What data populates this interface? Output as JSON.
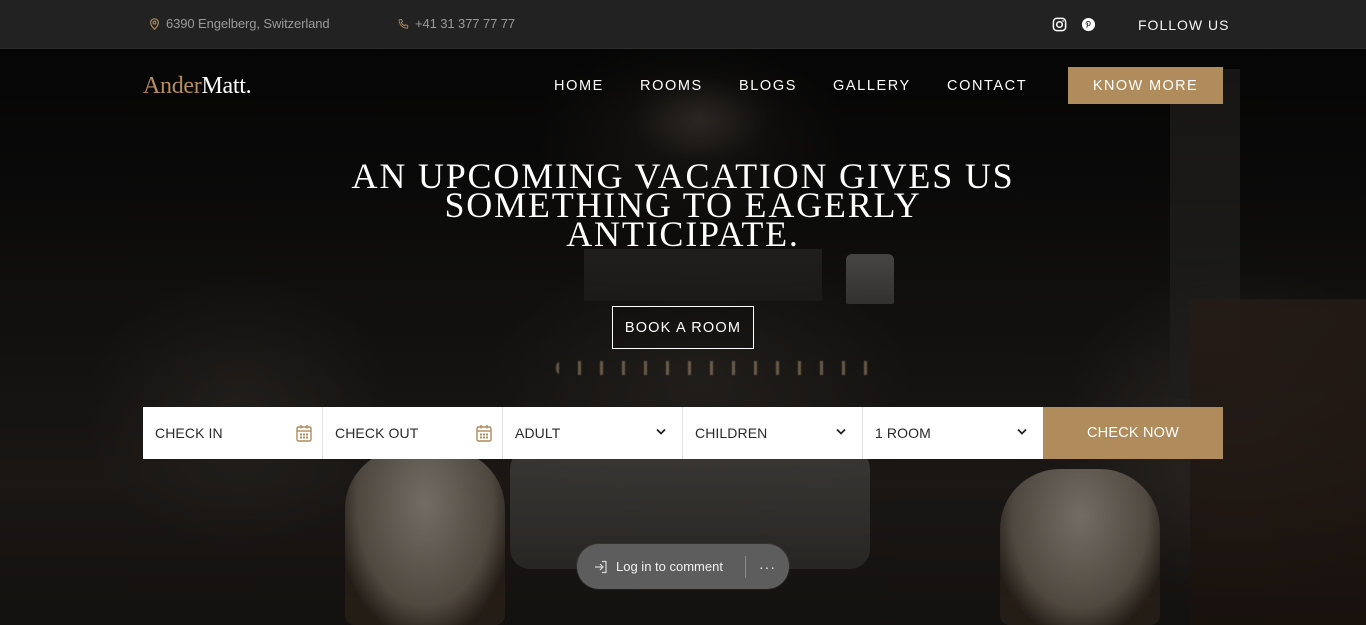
{
  "topbar": {
    "address": "6390 Engelberg, Switzerland",
    "phone": "+41 31 377 77 77",
    "follow_label": "FOLLOW US",
    "social_icons": [
      "instagram-icon",
      "pinterest-icon"
    ]
  },
  "brand": {
    "logo_part1": "Ander",
    "logo_part2": "Matt.",
    "accent_color": "#b08b5b"
  },
  "nav": {
    "items": [
      {
        "label": "HOME"
      },
      {
        "label": "ROOMS"
      },
      {
        "label": "BLOGS"
      },
      {
        "label": "GALLERY"
      },
      {
        "label": "CONTACT"
      }
    ],
    "cta_label": "KNOW MORE"
  },
  "hero": {
    "headline_line1": "AN UPCOMING VACATION GIVES US",
    "headline_line2": "SOMETHING TO EAGERLY",
    "headline_line3": "ANTICIPATE.",
    "book_label": "BOOK A ROOM"
  },
  "booking": {
    "check_in": "CHECK IN",
    "check_out": "CHECK OUT",
    "adult": "ADULT",
    "children": "CHILDREN",
    "rooms": "1 ROOM",
    "submit_label": "CHECK NOW"
  },
  "comment_bar": {
    "login_label": "Log in to comment",
    "more_label": "···"
  }
}
